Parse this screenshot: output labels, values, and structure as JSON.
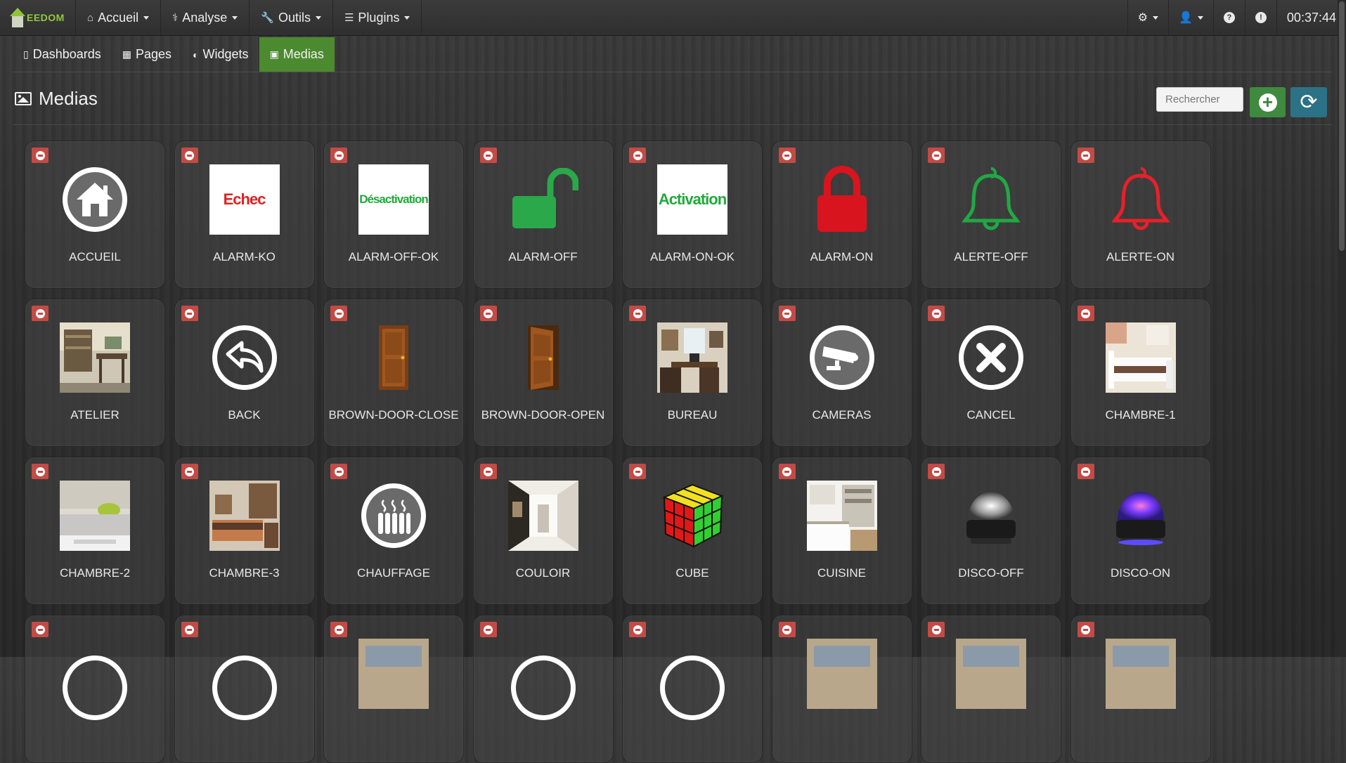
{
  "navbar": {
    "brand": "EEDOM",
    "items": [
      {
        "label": "Accueil",
        "icon": "home-icon"
      },
      {
        "label": "Analyse",
        "icon": "stethoscope-icon"
      },
      {
        "label": "Outils",
        "icon": "wrench-icon"
      },
      {
        "label": "Plugins",
        "icon": "list-icon"
      }
    ],
    "time": "00:37:44"
  },
  "tabs": [
    {
      "label": "Dashboards",
      "icon": "tablet-icon"
    },
    {
      "label": "Pages",
      "icon": "table-icon"
    },
    {
      "label": "Widgets",
      "icon": "dashboard-icon"
    },
    {
      "label": "Medias",
      "icon": "picture-icon",
      "active": true
    }
  ],
  "page": {
    "title": "Medias",
    "search_placeholder": "Rechercher"
  },
  "colors": {
    "active_tab": "#4c8a2f",
    "add_button": "#3f8a3f",
    "refresh_button": "#2b7286",
    "delete_button": "#c44a45",
    "brand": "#93c83e"
  },
  "medias": [
    {
      "name": "ACCUEIL",
      "icon": "home-circle-icon"
    },
    {
      "name": "ALARM-KO",
      "icon": "echec-image",
      "text": "Echec",
      "color": "#e02020"
    },
    {
      "name": "ALARM-OFF-OK",
      "icon": "desactivation-image",
      "text": "Désactivation",
      "color": "#1faa3a"
    },
    {
      "name": "ALARM-OFF",
      "icon": "unlock-icon",
      "color": "#2aa84a"
    },
    {
      "name": "ALARM-ON-OK",
      "icon": "activation-image",
      "text": "Activation",
      "color": "#1faa3a"
    },
    {
      "name": "ALARM-ON",
      "icon": "lock-icon",
      "color": "#d8141e"
    },
    {
      "name": "ALERTE-OFF",
      "icon": "bell-icon",
      "color": "#21a844"
    },
    {
      "name": "ALERTE-ON",
      "icon": "bell-icon",
      "color": "#e8202a"
    },
    {
      "name": "ATELIER",
      "icon": "atelier-photo"
    },
    {
      "name": "BACK",
      "icon": "back-circle-icon"
    },
    {
      "name": "BROWN-DOOR-CLOSE",
      "icon": "door-closed-icon"
    },
    {
      "name": "BROWN-DOOR-OPEN",
      "icon": "door-open-icon"
    },
    {
      "name": "BUREAU",
      "icon": "bureau-photo"
    },
    {
      "name": "CAMERAS",
      "icon": "camera-circle-icon"
    },
    {
      "name": "CANCEL",
      "icon": "cancel-circle-icon"
    },
    {
      "name": "CHAMBRE-1",
      "icon": "chambre1-photo"
    },
    {
      "name": "CHAMBRE-2",
      "icon": "chambre2-photo"
    },
    {
      "name": "CHAMBRE-3",
      "icon": "chambre3-photo"
    },
    {
      "name": "CHAUFFAGE",
      "icon": "heater-circle-icon"
    },
    {
      "name": "COULOIR",
      "icon": "couloir-photo"
    },
    {
      "name": "CUBE",
      "icon": "rubik-cube-icon"
    },
    {
      "name": "CUISINE",
      "icon": "cuisine-photo"
    },
    {
      "name": "DISCO-OFF",
      "icon": "disco-ball-off-icon"
    },
    {
      "name": "DISCO-ON",
      "icon": "disco-ball-on-icon"
    },
    {
      "name": "",
      "icon": "partial-icon"
    },
    {
      "name": "",
      "icon": "partial-icon"
    },
    {
      "name": "",
      "icon": "partial-photo"
    },
    {
      "name": "",
      "icon": "partial-icon"
    },
    {
      "name": "",
      "icon": "partial-icon"
    },
    {
      "name": "",
      "icon": "partial-photo"
    },
    {
      "name": "",
      "icon": "partial-photo"
    },
    {
      "name": "",
      "icon": "partial-photo"
    }
  ]
}
